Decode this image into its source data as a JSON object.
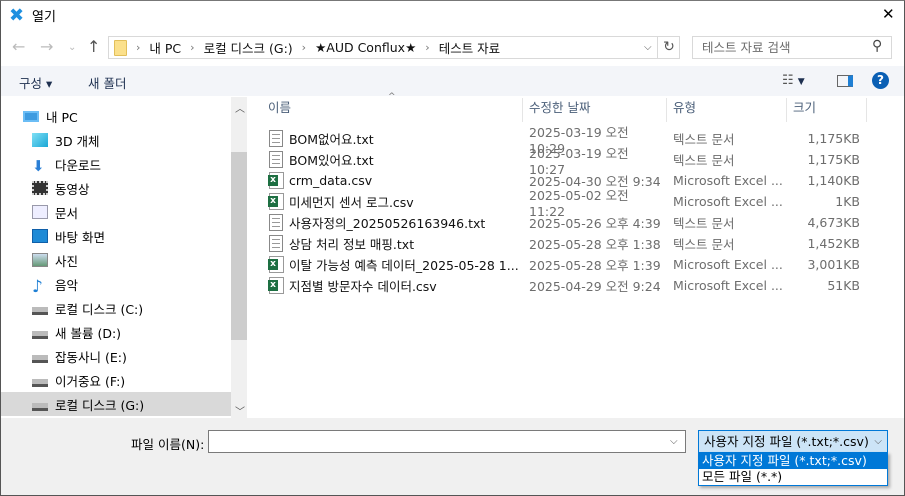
{
  "window": {
    "title": "열기",
    "close": "✕"
  },
  "address": {
    "crumbs": [
      "내 PC",
      "로컬 디스크 (G:)",
      "★AUD Conflux★",
      "테스트 자료"
    ],
    "sep": "›"
  },
  "search": {
    "placeholder": "테스트 자료 검색"
  },
  "toolbar": {
    "organize": "구성 ▾",
    "new_folder": "새 폴더",
    "help": "?"
  },
  "nav": [
    {
      "label": "내 PC",
      "icon": "pc-icon"
    },
    {
      "label": "3D 개체",
      "icon": "cube-icon"
    },
    {
      "label": "다운로드",
      "icon": "download-icon"
    },
    {
      "label": "동영상",
      "icon": "video-icon"
    },
    {
      "label": "문서",
      "icon": "document-icon"
    },
    {
      "label": "바탕 화면",
      "icon": "desktop-icon"
    },
    {
      "label": "사진",
      "icon": "picture-icon"
    },
    {
      "label": "음악",
      "icon": "music-icon"
    },
    {
      "label": "로컬 디스크 (C:)",
      "icon": "drive-icon"
    },
    {
      "label": "새 볼륨 (D:)",
      "icon": "drive-icon"
    },
    {
      "label": "잡동사니 (E:)",
      "icon": "drive-icon"
    },
    {
      "label": "이거중요 (F:)",
      "icon": "drive-icon"
    },
    {
      "label": "로컬 디스크 (G:)",
      "icon": "drive-icon",
      "selected": true
    }
  ],
  "columns": {
    "name": "이름",
    "date": "수정한 날짜",
    "type": "유형",
    "size": "크기"
  },
  "files": [
    {
      "name": "BOM없어요.txt",
      "date": "2025-03-19 오전 10:29",
      "type": "텍스트 문서",
      "size": "1,175KB",
      "kind": "txt"
    },
    {
      "name": "BOM있어요.txt",
      "date": "2025-03-19 오전 10:27",
      "type": "텍스트 문서",
      "size": "1,175KB",
      "kind": "txt"
    },
    {
      "name": "crm_data.csv",
      "date": "2025-04-30 오전 9:34",
      "type": "Microsoft Excel ...",
      "size": "1,140KB",
      "kind": "csv"
    },
    {
      "name": "미세먼지 센서 로그.csv",
      "date": "2025-05-02 오전 11:22",
      "type": "Microsoft Excel ...",
      "size": "1KB",
      "kind": "csv"
    },
    {
      "name": "사용자정의_20250526163946.txt",
      "date": "2025-05-26 오후 4:39",
      "type": "텍스트 문서",
      "size": "4,673KB",
      "kind": "txt"
    },
    {
      "name": "상담 처리 정보 매핑.txt",
      "date": "2025-05-28 오후 1:38",
      "type": "텍스트 문서",
      "size": "1,452KB",
      "kind": "txt"
    },
    {
      "name": "이탈 가능성 예측 데이터_2025-05-28 1...",
      "date": "2025-05-28 오후 1:39",
      "type": "Microsoft Excel ...",
      "size": "3,001KB",
      "kind": "csv"
    },
    {
      "name": "지점별 방문자수 데이터.csv",
      "date": "2025-04-29 오전 9:24",
      "type": "Microsoft Excel ...",
      "size": "51KB",
      "kind": "csv"
    }
  ],
  "bottom": {
    "filename_label": "파일 이름(N):",
    "filename_value": "",
    "filter_selected": "사용자 지정 파일 (*.txt;*.csv)",
    "filter_options": [
      "사용자 지정 파일 (*.txt;*.csv)",
      "모든 파일 (*.*)"
    ]
  }
}
